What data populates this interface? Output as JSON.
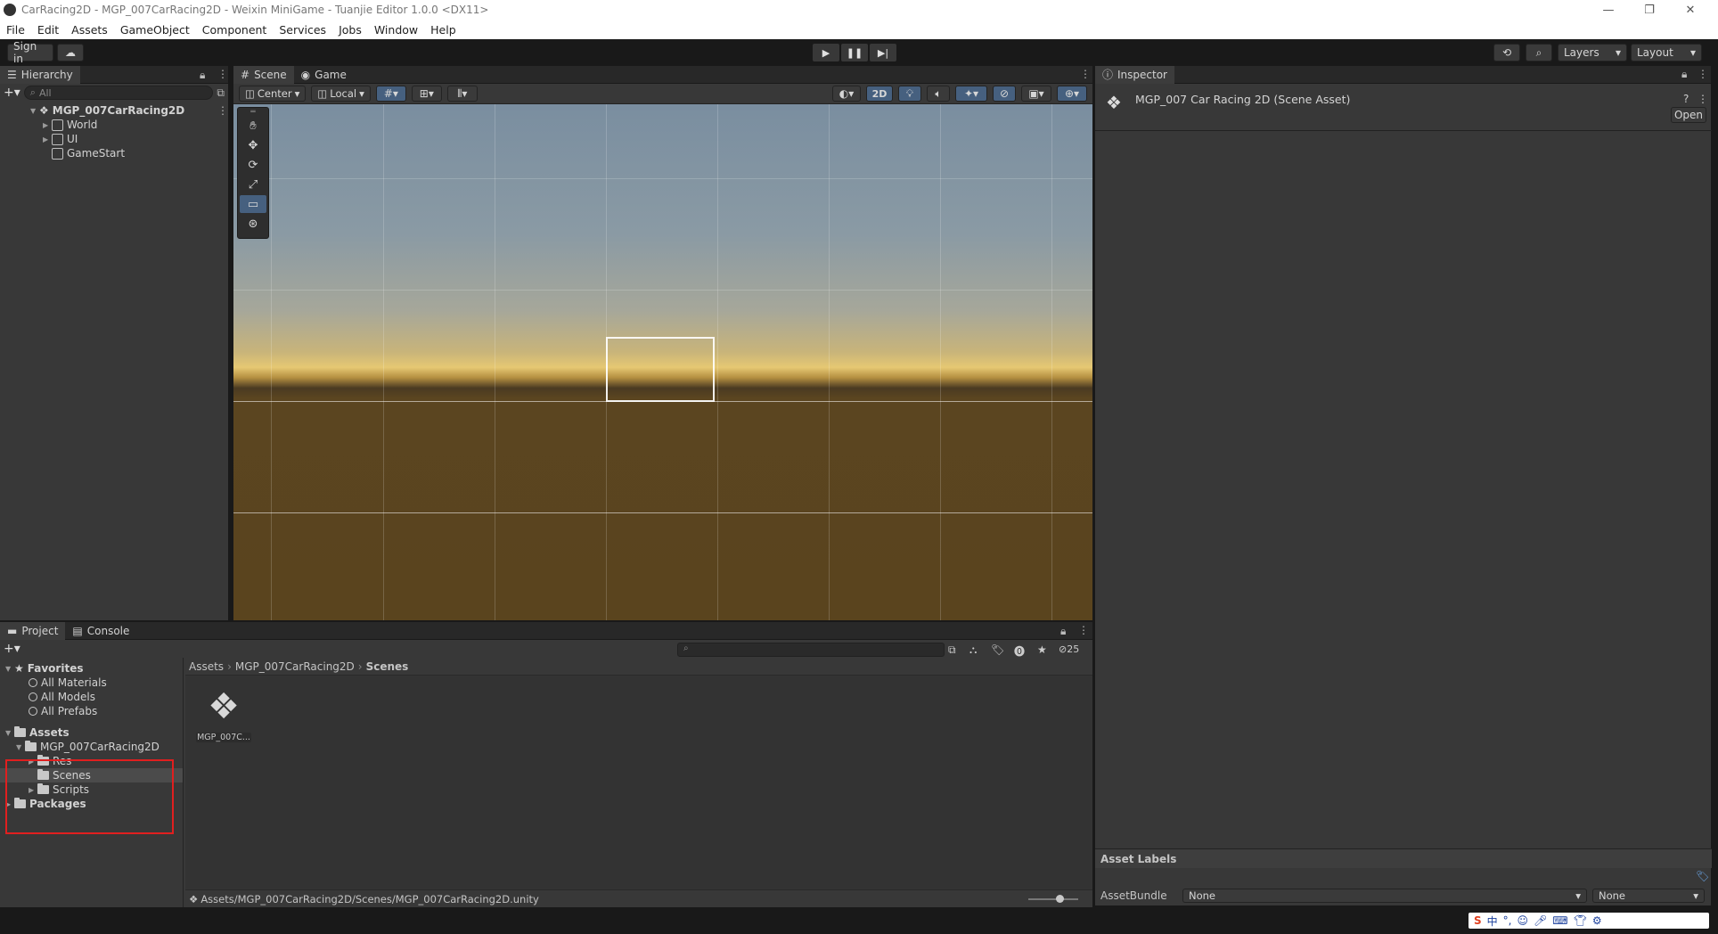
{
  "window": {
    "title": "CarRacing2D - MGP_007CarRacing2D - Weixin MiniGame - Tuanjie Editor 1.0.0 <DX11>"
  },
  "menu": [
    "File",
    "Edit",
    "Assets",
    "GameObject",
    "Component",
    "Services",
    "Jobs",
    "Window",
    "Help"
  ],
  "toolbar": {
    "sign_in": "Sign in",
    "layers": "Layers",
    "layout": "Layout"
  },
  "hierarchy": {
    "tab": "Hierarchy",
    "search_placeholder": "All",
    "scene": "MGP_007CarRacing2D",
    "items": [
      "World",
      "UI",
      "GameStart"
    ]
  },
  "scene": {
    "tabs": [
      "Scene",
      "Game"
    ],
    "pivot": "Center",
    "space": "Local",
    "mode_2d": "2D"
  },
  "inspector": {
    "tab": "Inspector",
    "asset_title": "MGP_007 Car Racing 2D (Scene Asset)",
    "open_button": "Open",
    "asset_labels": "Asset Labels",
    "assetbundle_label": "AssetBundle",
    "assetbundle_value": "None",
    "variant_value": "None"
  },
  "project": {
    "tabs": [
      "Project",
      "Console"
    ],
    "favorites": "Favorites",
    "fav_items": [
      "All Materials",
      "All Models",
      "All Prefabs"
    ],
    "assets": "Assets",
    "folder_root": "MGP_007CarRacing2D",
    "subfolders": [
      "Res",
      "Scenes",
      "Scripts"
    ],
    "packages": "Packages",
    "breadcrumb": [
      "Assets",
      "MGP_007CarRacing2D",
      "Scenes"
    ],
    "file_label": "MGP_007C...",
    "hidden_count": "25",
    "path": "Assets/MGP_007CarRacing2D/Scenes/MGP_007CarRacing2D.unity"
  },
  "colors": {
    "highlight_box": "#e01f1f",
    "selected_tool": "#46607f"
  }
}
